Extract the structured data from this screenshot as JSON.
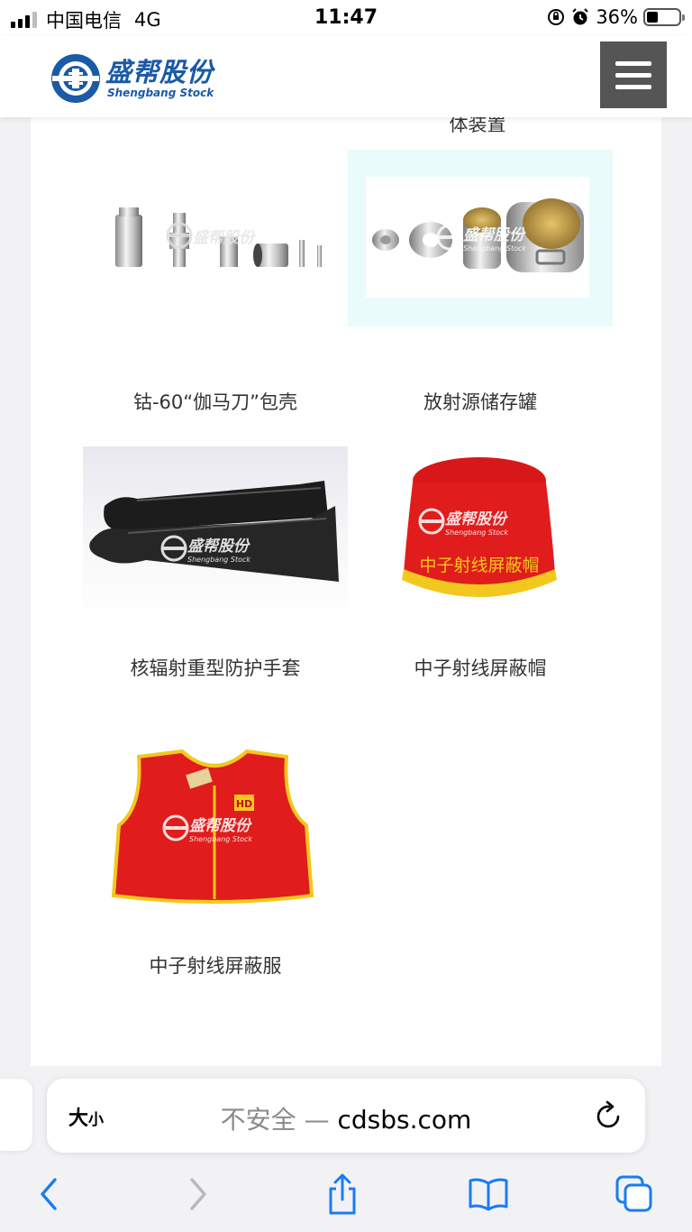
{
  "status_bar": {
    "carrier": "中国电信",
    "network": "4G",
    "time": "11:47",
    "battery_percent": "36%",
    "battery_level": 0.36
  },
  "header": {
    "logo_cn": "盛帮股份",
    "logo_en": "Shengbang Stock",
    "menu_icon": "hamburger-menu-icon"
  },
  "products": {
    "cut_caption": "体装置",
    "items": [
      {
        "caption": "钴-60“伽马刀”包壳"
      },
      {
        "caption": "放射源储存罐"
      },
      {
        "caption": "核辐射重型防护手套"
      },
      {
        "caption": "中子射线屏蔽帽"
      },
      {
        "caption": "中子射线屏蔽服"
      }
    ],
    "watermark_cn": "盛帮股份",
    "watermark_en": "Shengbang Stock",
    "hat_text": "中子射线屏蔽帽",
    "vest_badge": "HD"
  },
  "browser": {
    "text_size_big": "大",
    "text_size_small": "小",
    "insecure_label": "不安全 —",
    "domain": "cdsbs.com",
    "icons": [
      "reload-icon",
      "back-icon",
      "forward-icon",
      "share-icon",
      "bookmarks-icon",
      "tabs-icon"
    ]
  },
  "colors": {
    "brand_blue": "#1a5aa6",
    "accent_blue": "#1a7cf2",
    "product_red": "#e01c1c",
    "trim_yellow": "#f2c81e"
  }
}
